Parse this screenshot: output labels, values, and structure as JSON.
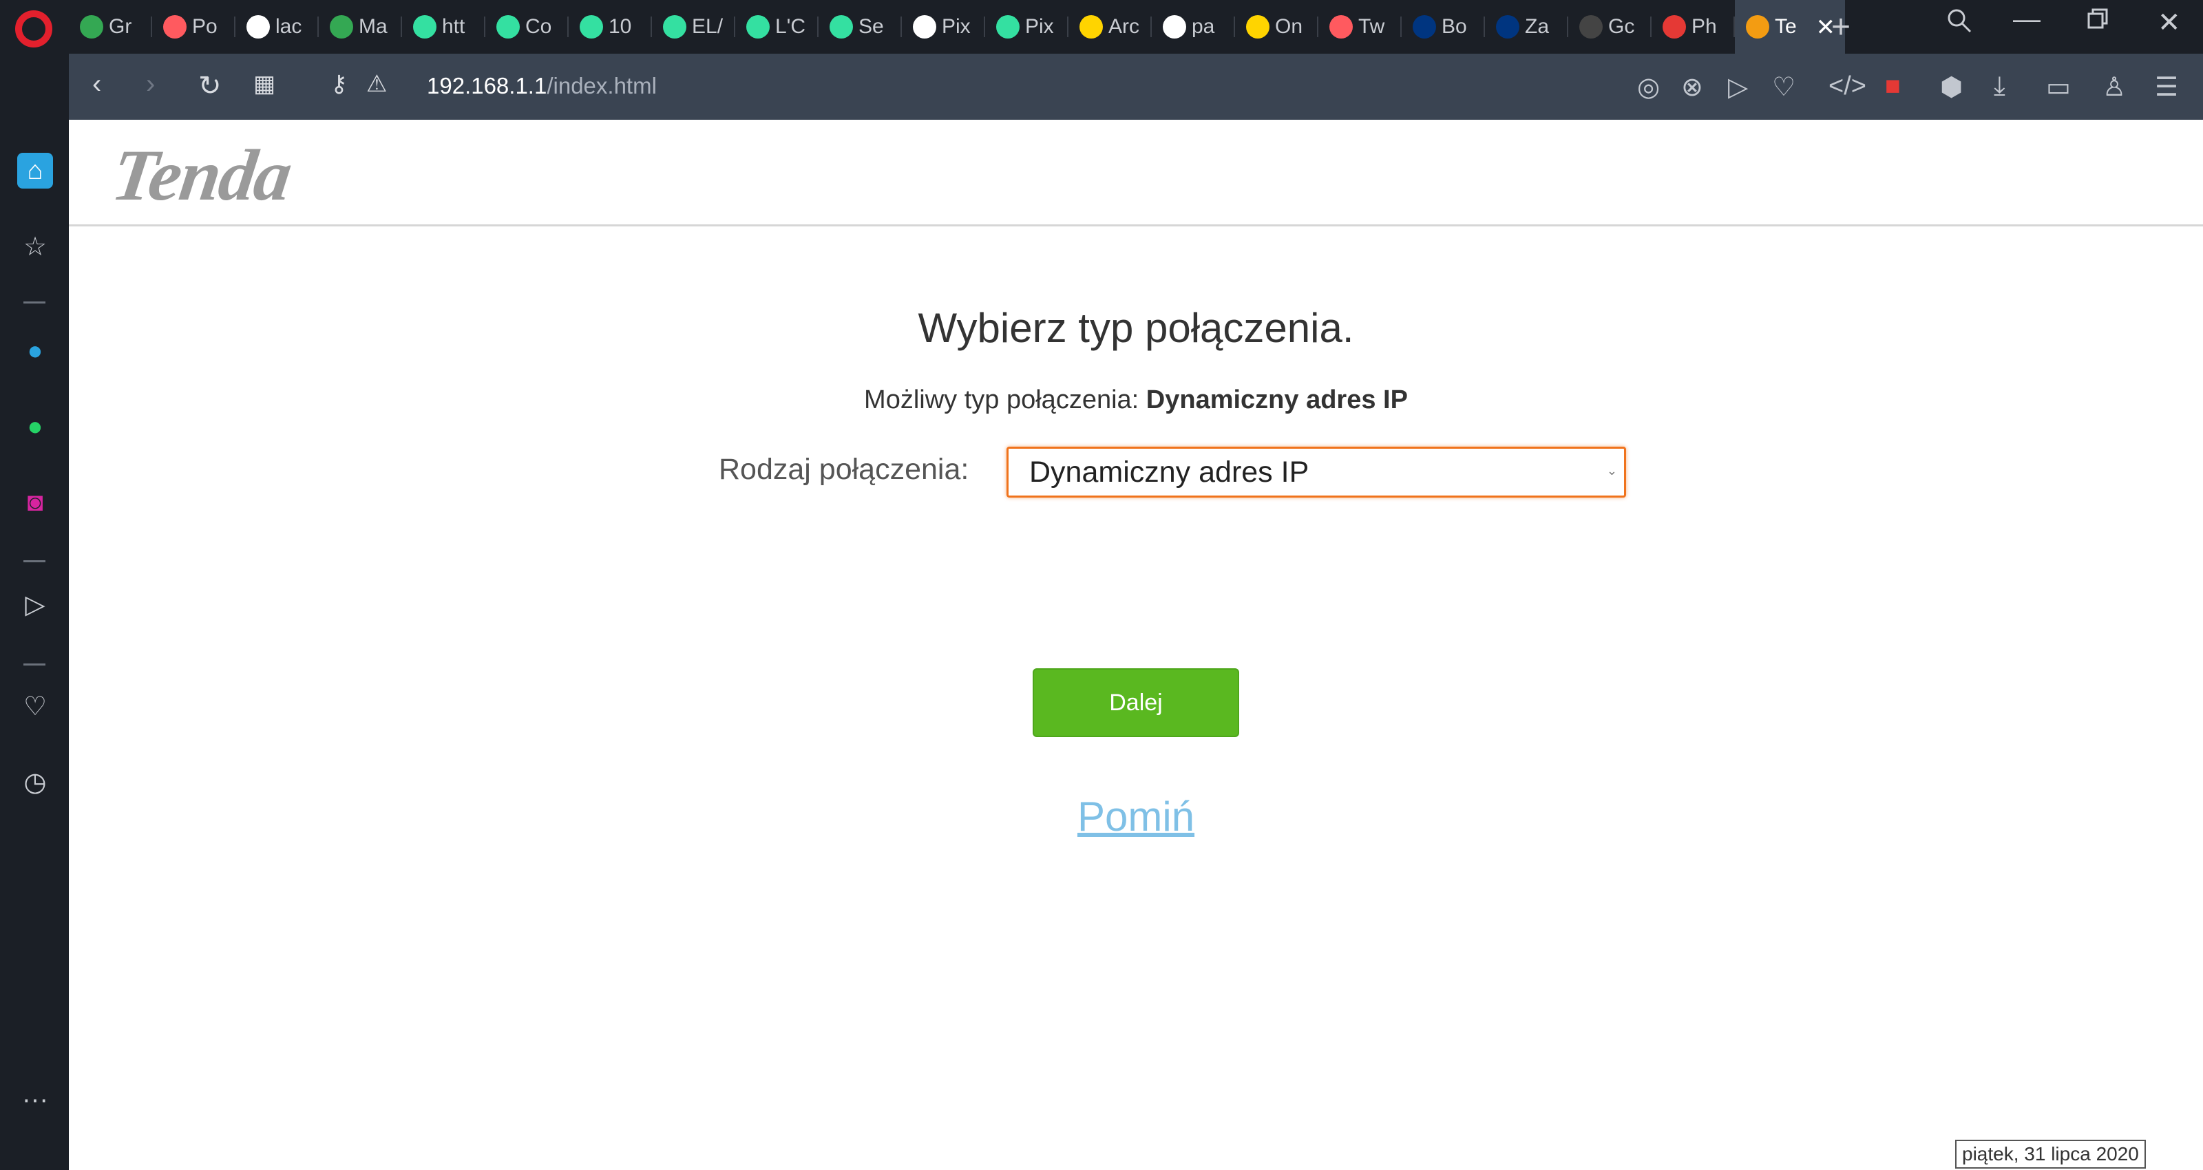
{
  "browser": {
    "tabs": [
      {
        "label": "Gr",
        "icon": "google-maps-icon",
        "color": "#34a853"
      },
      {
        "label": "Po",
        "icon": "airbnb-icon",
        "color": "#ff5a5f"
      },
      {
        "label": "lac",
        "icon": "google-icon",
        "color": "#ffffff"
      },
      {
        "label": "Ma",
        "icon": "google-maps-icon",
        "color": "#34a853"
      },
      {
        "label": "htt",
        "icon": "tripadvisor-icon",
        "color": "#34e0a1"
      },
      {
        "label": "Co",
        "icon": "tripadvisor-icon",
        "color": "#34e0a1"
      },
      {
        "label": "10",
        "icon": "tripadvisor-icon",
        "color": "#34e0a1"
      },
      {
        "label": "EL/",
        "icon": "tripadvisor-icon",
        "color": "#34e0a1"
      },
      {
        "label": "L'C",
        "icon": "tripadvisor-icon",
        "color": "#34e0a1"
      },
      {
        "label": "Se",
        "icon": "tripadvisor-icon",
        "color": "#34e0a1"
      },
      {
        "label": "Pix",
        "icon": "document-icon",
        "color": "#ffffff"
      },
      {
        "label": "Pix",
        "icon": "tripadvisor-icon",
        "color": "#34e0a1"
      },
      {
        "label": "Arc",
        "icon": "mt-icon",
        "color": "#ffd400"
      },
      {
        "label": "pa",
        "icon": "google-icon",
        "color": "#ffffff"
      },
      {
        "label": "On",
        "icon": "circle-icon",
        "color": "#ffd400"
      },
      {
        "label": "Tw",
        "icon": "airbnb-icon",
        "color": "#ff5a5f"
      },
      {
        "label": "Bo",
        "icon": "booking-icon",
        "color": "#003580"
      },
      {
        "label": "Za",
        "icon": "booking-icon",
        "color": "#003580"
      },
      {
        "label": "Gc",
        "icon": "eye-icon",
        "color": "#444444"
      },
      {
        "label": "Ph",
        "icon": "c-icon",
        "color": "#e53935"
      }
    ],
    "active_tab": {
      "label": "Te",
      "icon": "tenda-icon",
      "color": "#f39c12"
    },
    "address": {
      "host": "192.168.1.1",
      "path": "/index.html"
    }
  },
  "page": {
    "logo": "Tenda",
    "title": "Wybierz typ połączenia.",
    "possible_label": "Możliwy typ połączenia:",
    "possible_value": "Dynamiczny adres IP",
    "connection_label": "Rodzaj połączenia:",
    "connection_value": "Dynamiczny adres IP",
    "next_button": "Dalej",
    "skip_link": "Pomiń"
  },
  "tooltip": "piątek, 31 lipca 2020",
  "colors": {
    "accent_green": "#5ab820",
    "select_border": "#f0731c",
    "link": "#7fc0e6"
  }
}
